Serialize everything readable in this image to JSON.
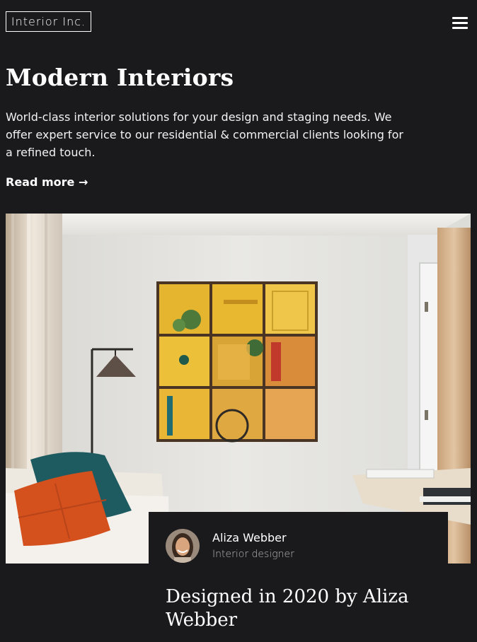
{
  "brand": {
    "logo_text": "Interior Inc."
  },
  "header": {
    "menu_icon": "hamburger-menu-icon"
  },
  "hero": {
    "title": "Modern Interiors",
    "description": "World-class interior solutions for your design and staging needs. We offer expert service to our residential & commercial clients looking for a refined touch.",
    "read_more": "Read more →"
  },
  "author_card": {
    "name": "Aliza Webber",
    "role": "Interior designer",
    "title": "Designed in 2020 by Aliza Webber"
  },
  "colors": {
    "background": "#1a1a1c",
    "text": "#ffffff",
    "muted_text": "#b8b8b8"
  }
}
